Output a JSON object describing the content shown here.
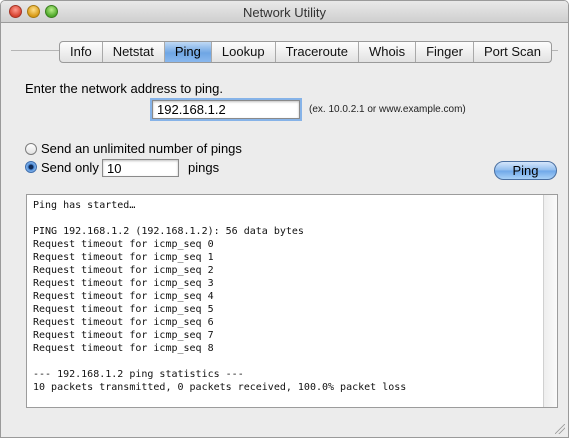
{
  "window": {
    "title": "Network Utility"
  },
  "tabs": [
    "Info",
    "Netstat",
    "Ping",
    "Lookup",
    "Traceroute",
    "Whois",
    "Finger",
    "Port Scan"
  ],
  "active_tab": "Ping",
  "form": {
    "address_label": "Enter the network address to ping.",
    "address_value": "192.168.1.2",
    "address_hint": "(ex. 10.0.2.1 or www.example.com)",
    "radio_unlimited": "Send an unlimited number of pings",
    "radio_only": "Send only",
    "count_value": "10",
    "pings_label": "pings",
    "selected_radio": "only",
    "ping_button": "Ping"
  },
  "output": {
    "lines": [
      "Ping has started…",
      "",
      "PING 192.168.1.2 (192.168.1.2): 56 data bytes",
      "Request timeout for icmp_seq 0",
      "Request timeout for icmp_seq 1",
      "Request timeout for icmp_seq 2",
      "Request timeout for icmp_seq 3",
      "Request timeout for icmp_seq 4",
      "Request timeout for icmp_seq 5",
      "Request timeout for icmp_seq 6",
      "Request timeout for icmp_seq 7",
      "Request timeout for icmp_seq 8",
      "",
      "--- 192.168.1.2 ping statistics ---",
      "10 packets transmitted, 0 packets received, 100.0% packet loss"
    ]
  }
}
